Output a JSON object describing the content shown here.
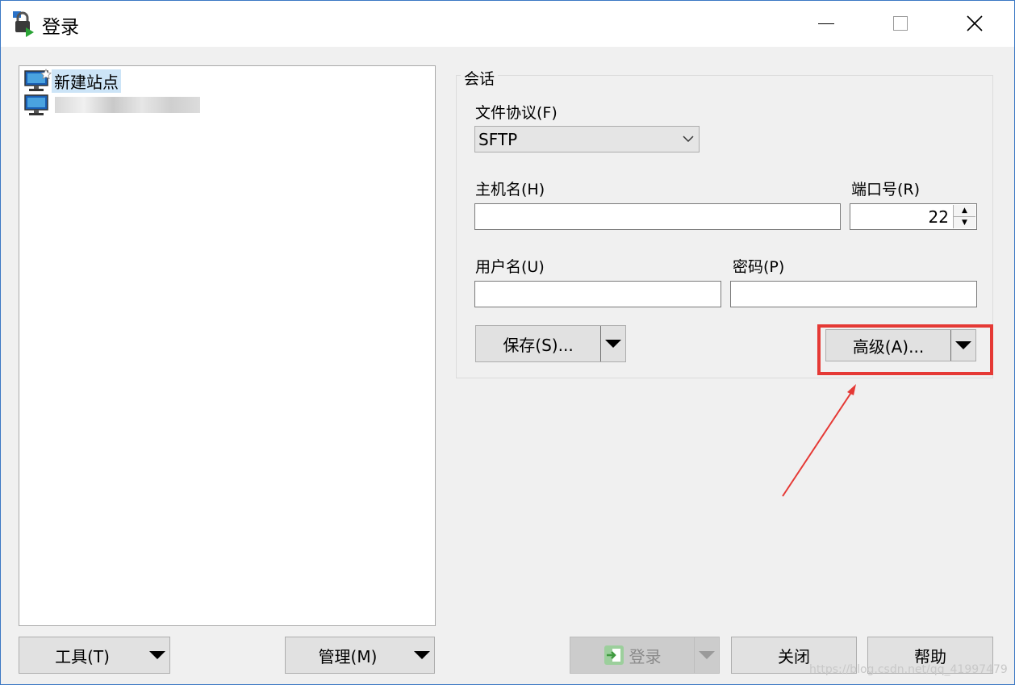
{
  "window": {
    "title": "登录",
    "icon": "lock-login-icon",
    "controls": [
      "minimize-icon",
      "maximize-icon",
      "close-icon"
    ]
  },
  "sites": [
    {
      "label": "新建站点",
      "icon": "new-site-monitor-icon",
      "selected": true
    },
    {
      "label": "",
      "icon": "monitor-icon",
      "blurred": true
    }
  ],
  "session": {
    "legend": "会话",
    "protocol_label": "文件协议(F)",
    "protocol_value": "SFTP",
    "host_label": "主机名(H)",
    "host_value": "",
    "port_label": "端口号(R)",
    "port_value": "22",
    "user_label": "用户名(U)",
    "user_value": "",
    "password_label": "密码(P)",
    "password_value": "",
    "save_button": "保存(S)...",
    "advanced_button": "高级(A)..."
  },
  "bottom": {
    "tools_button": "工具(T)",
    "manage_button": "管理(M)",
    "login_button": "登录",
    "close_button": "关闭",
    "help_button": "帮助"
  },
  "annotation": {
    "highlight_color": "#e53935"
  },
  "watermark": "https://blog.csdn.net/qq_41997479"
}
